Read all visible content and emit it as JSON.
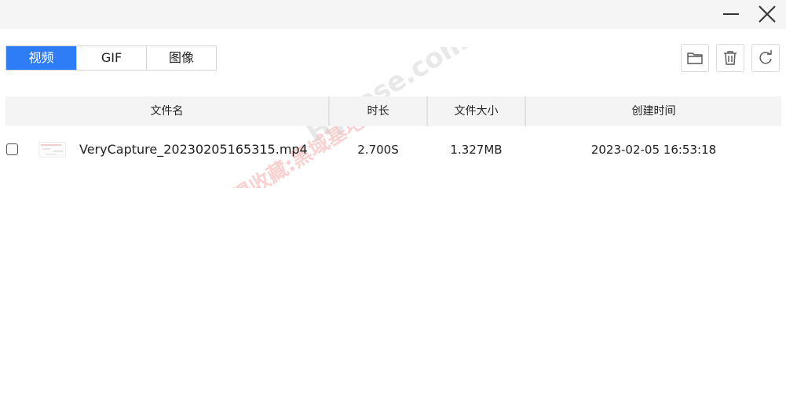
{
  "window": {
    "minimize_icon": "minimize-icon",
    "close_icon": "close-icon"
  },
  "tabs": [
    {
      "label": "视频",
      "active": true
    },
    {
      "label": "GIF",
      "active": false
    },
    {
      "label": "图像",
      "active": false
    }
  ],
  "toolbar": {
    "open_folder_icon": "folder-icon",
    "delete_icon": "trash-icon",
    "refresh_icon": "refresh-icon"
  },
  "table": {
    "columns": [
      "文件名",
      "时长",
      "文件大小",
      "创建时间"
    ],
    "rows": [
      {
        "checked": false,
        "file_name": "VeryCapture_20230205165315.mp4",
        "duration": "2.700S",
        "size": "1.327MB",
        "created": "2023-02-05 16:53:18"
      }
    ]
  },
  "watermark": {
    "line1": "记得收藏:黑域基地",
    "line2": "Hybase.com"
  },
  "colors": {
    "accent": "#2f7df6",
    "header_bg": "#f4f4f4",
    "titlebar_bg": "#f5f5f5"
  }
}
